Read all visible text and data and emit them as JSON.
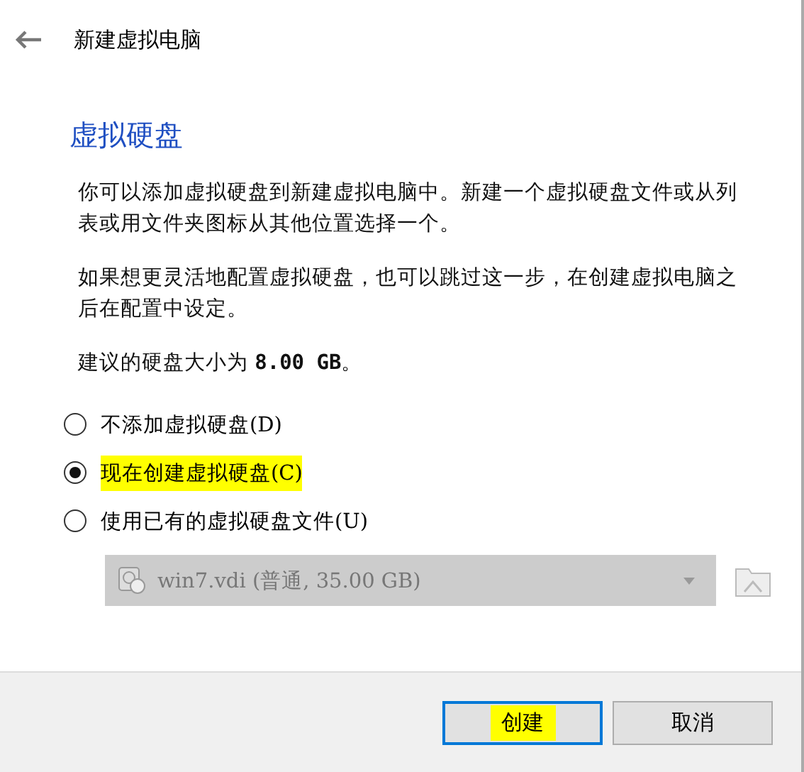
{
  "header": {
    "title": "新建虚拟电脑"
  },
  "section_title": "虚拟硬盘",
  "paragraphs": [
    "你可以添加虚拟硬盘到新建虚拟电脑中。新建一个虚拟硬盘文件或从列表或用文件夹图标从其他位置选择一个。",
    "如果想更灵活地配置虚拟硬盘，也可以跳过这一步，在创建虚拟电脑之后在配置中设定。",
    "建议的硬盘大小为 **8.00 GB**。"
  ],
  "options": [
    {
      "label": "不添加虚拟硬盘(D)",
      "selected": false,
      "highlighted": false
    },
    {
      "label": "现在创建虚拟硬盘(C)",
      "selected": true,
      "highlighted": true
    },
    {
      "label": "使用已有的虚拟硬盘文件(U)",
      "selected": false,
      "highlighted": false
    }
  ],
  "disk_select": {
    "value": "win7.vdi (普通, 35.00 GB)",
    "disabled": true
  },
  "buttons": [
    {
      "label": "创建",
      "default": true,
      "highlighted": true
    },
    {
      "label": "取消",
      "default": false,
      "highlighted": false
    }
  ]
}
